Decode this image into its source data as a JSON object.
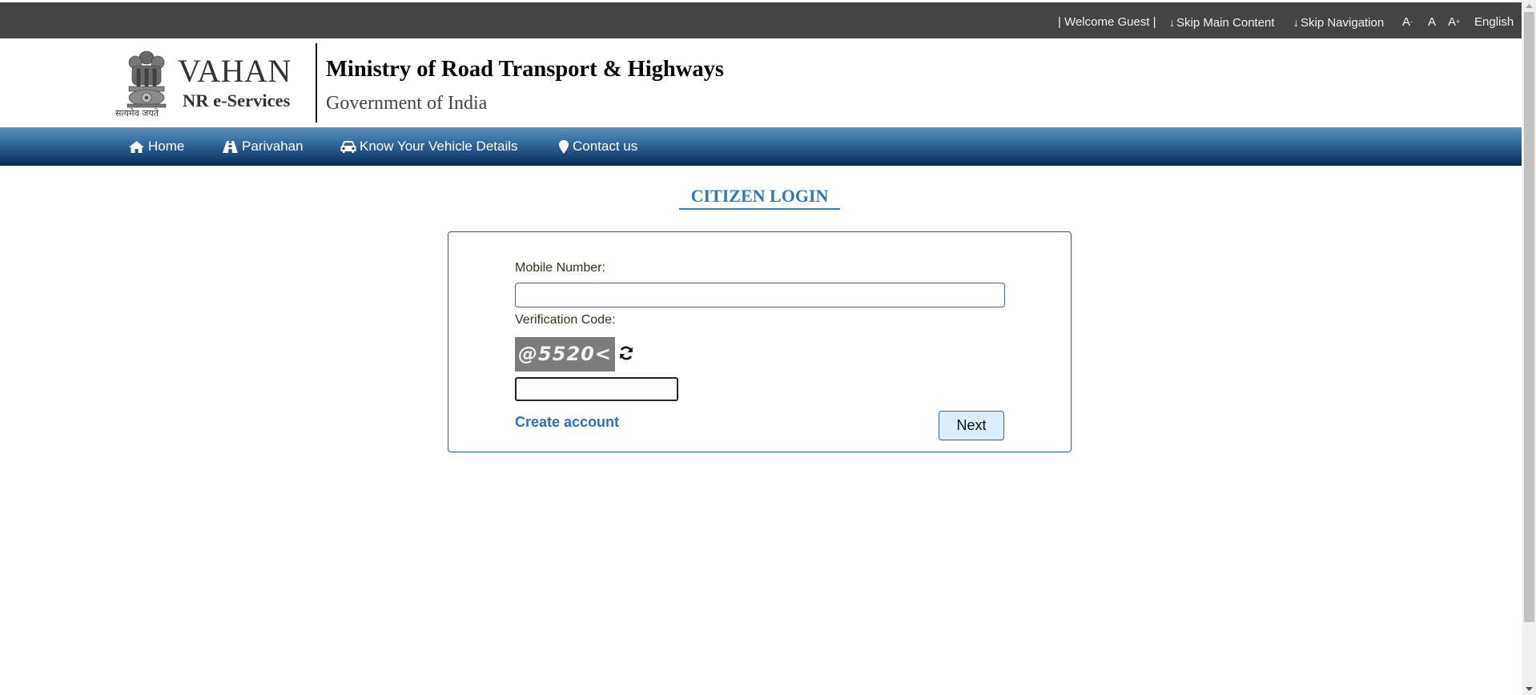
{
  "topbar": {
    "welcome": "| Welcome Guest |",
    "skip_main": "Skip Main Content",
    "skip_nav": "Skip Navigation",
    "font_decrease": "A",
    "font_decrease_sup": "-",
    "font_normal": "A",
    "font_increase": "A",
    "font_increase_sup": "+",
    "language": "English"
  },
  "header": {
    "emblem_caption": "सत्यमेव जयते",
    "logo_title": "VAHAN",
    "logo_subtitle": "NR e-Services",
    "ministry": "Ministry of Road Transport & Highways",
    "government": "Government of India"
  },
  "nav": {
    "items": [
      {
        "label": "Home",
        "icon": "home-icon"
      },
      {
        "label": "Parivahan",
        "icon": "road-icon"
      },
      {
        "label": "Know Your Vehicle Details",
        "icon": "car-icon"
      },
      {
        "label": "Contact us",
        "icon": "map-marker-icon"
      }
    ]
  },
  "login": {
    "heading": "CITIZEN LOGIN",
    "mobile_label": "Mobile Number:",
    "mobile_value": "",
    "verification_label": "Verification Code:",
    "captcha_text": "@5520<",
    "captcha_value": "",
    "create_account": "Create account",
    "next_button": "Next"
  },
  "colors": {
    "topbar_bg": "#444444",
    "nav_top": "#5d93c0",
    "nav_bottom": "#082750",
    "heading": "#2f79b5",
    "link": "#2a6fcb",
    "button_bg": "#ddeefb",
    "box_border": "#1f5e87"
  }
}
